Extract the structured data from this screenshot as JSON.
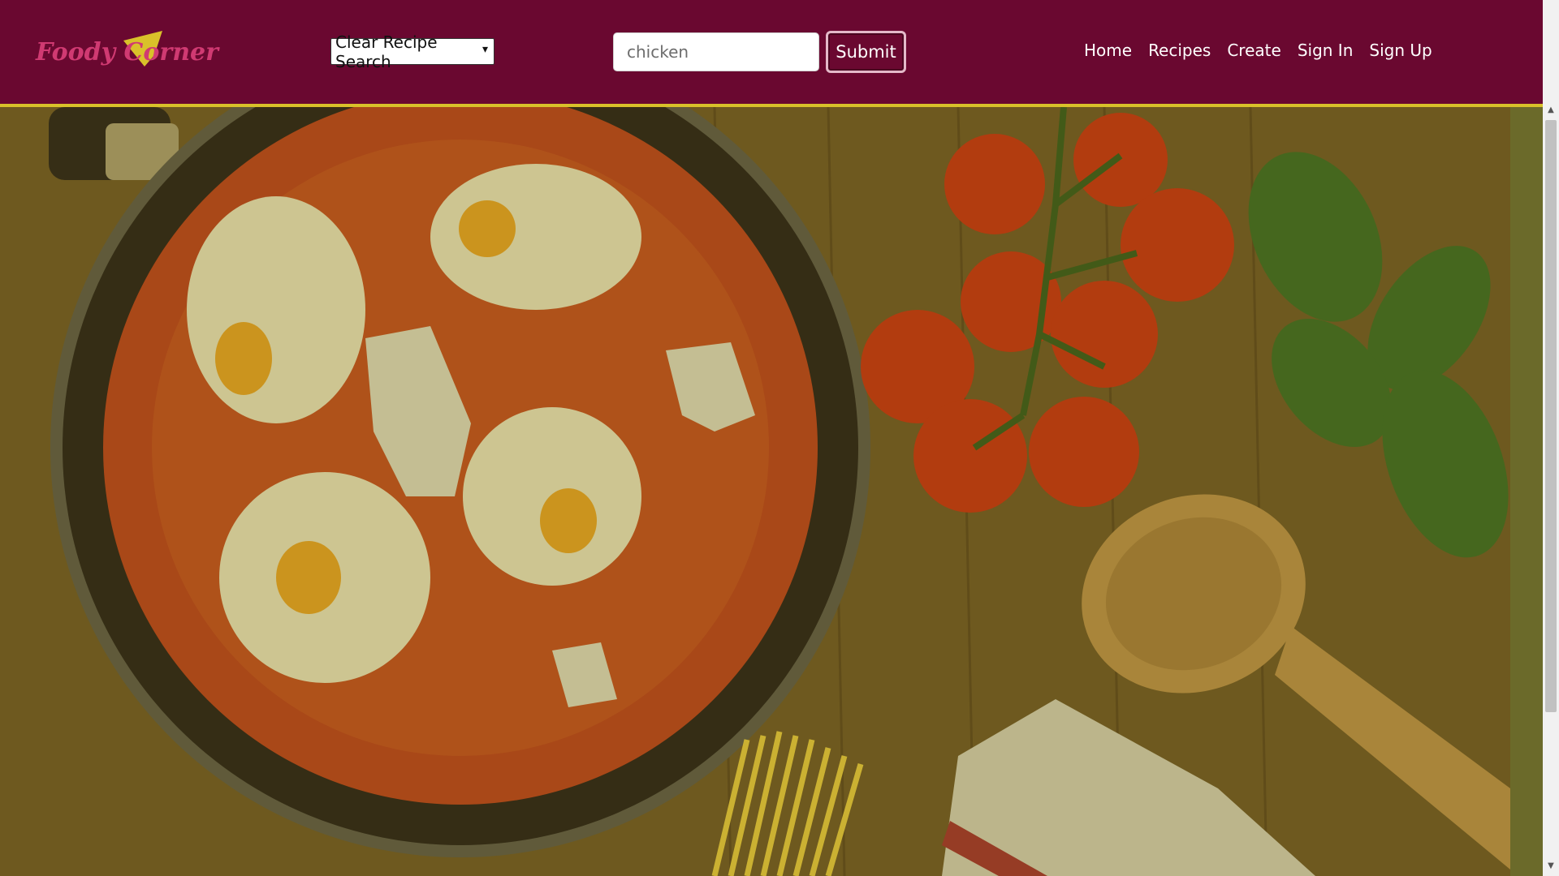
{
  "app": {
    "brand": "Foody Corner"
  },
  "search": {
    "recipe_select": "Clear Recipe Search",
    "query_value": "chicken",
    "submit_label": "Submit"
  },
  "nav": {
    "items": [
      {
        "label": "Home"
      },
      {
        "label": "Recipes"
      },
      {
        "label": "Create"
      },
      {
        "label": "Sign In"
      },
      {
        "label": "Sign Up"
      }
    ]
  },
  "colors": {
    "navbar_bg": "#6a0830",
    "accent_yellow": "#d9c12a",
    "brand_pink": "#d03a72"
  },
  "icons": {
    "select_caret": "caret-down-icon",
    "scroll_up": "scroll-up-arrow-icon",
    "scroll_down": "scroll-down-arrow-icon"
  }
}
